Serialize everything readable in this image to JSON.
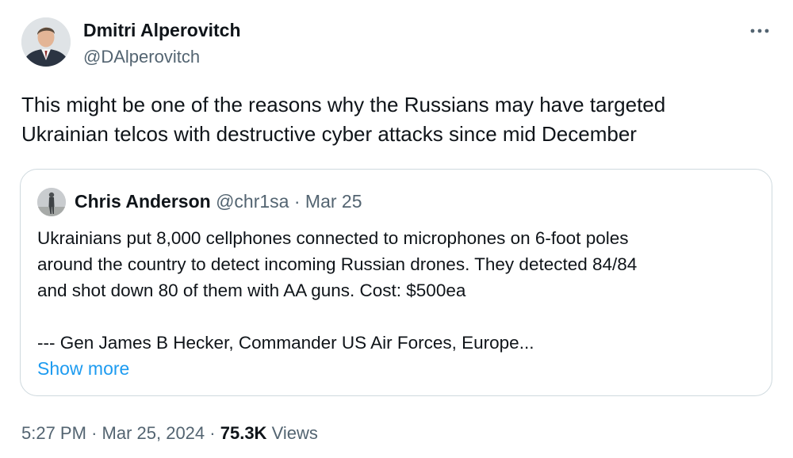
{
  "author": {
    "name": "Dmitri Alperovitch",
    "handle": "@DAlperovitch"
  },
  "tweet": {
    "text_lines": [
      "This might be one of the reasons why the Russians may have targeted",
      "Ukrainian telcos with destructive cyber attacks since mid December"
    ]
  },
  "quoted": {
    "name": "Chris Anderson",
    "handle": "@chr1sa",
    "separator": "·",
    "date": "Mar 25",
    "text_lines": [
      "Ukrainians put 8,000 cellphones connected to microphones on 6-foot poles",
      "around the country to detect incoming Russian drones. They detected 84/84",
      "and shot down 80 of them with AA guns.  Cost: $500ea",
      "",
      "--- Gen James B Hecker, Commander US Air Forces, Europe..."
    ],
    "show_more": "Show more"
  },
  "footer": {
    "time": "5:27 PM",
    "separator": "·",
    "date": "Mar 25, 2024",
    "views_count": "75.3K",
    "views_label": "Views"
  },
  "colors": {
    "text_primary": "#0f1419",
    "text_secondary": "#536471",
    "link": "#1d9bf0",
    "border": "#cfd9de"
  },
  "icons": {
    "more": "more-dots-icon"
  }
}
